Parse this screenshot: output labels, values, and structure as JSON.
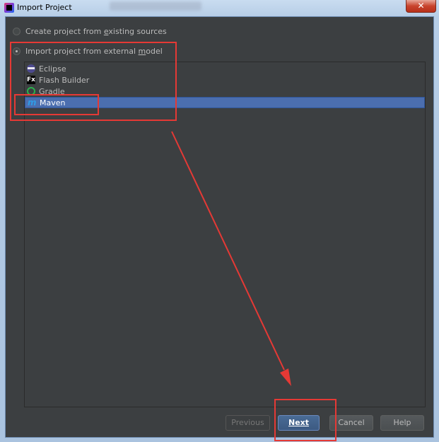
{
  "window": {
    "title": "Import Project",
    "close_symbol": "✕"
  },
  "options": [
    {
      "prefix": "Create project from ",
      "mnemonic": "e",
      "suffix": "xisting sources",
      "checked": false
    },
    {
      "prefix": "Import project from external ",
      "mnemonic": "m",
      "suffix": "odel",
      "checked": true
    }
  ],
  "models": [
    {
      "label": "Eclipse",
      "icon": "eclipse-icon"
    },
    {
      "label": "Flash Builder",
      "icon": "flash-builder-icon"
    },
    {
      "label": "Gradle",
      "icon": "gradle-icon"
    },
    {
      "label": "Maven",
      "icon": "maven-icon",
      "selected": true
    }
  ],
  "buttons": {
    "previous": "Previous",
    "next": "Next",
    "cancel": "Cancel",
    "help": "Help"
  },
  "colors": {
    "background": "#3c3f41",
    "selection": "#4b6eaf",
    "annotation": "#e53935"
  }
}
